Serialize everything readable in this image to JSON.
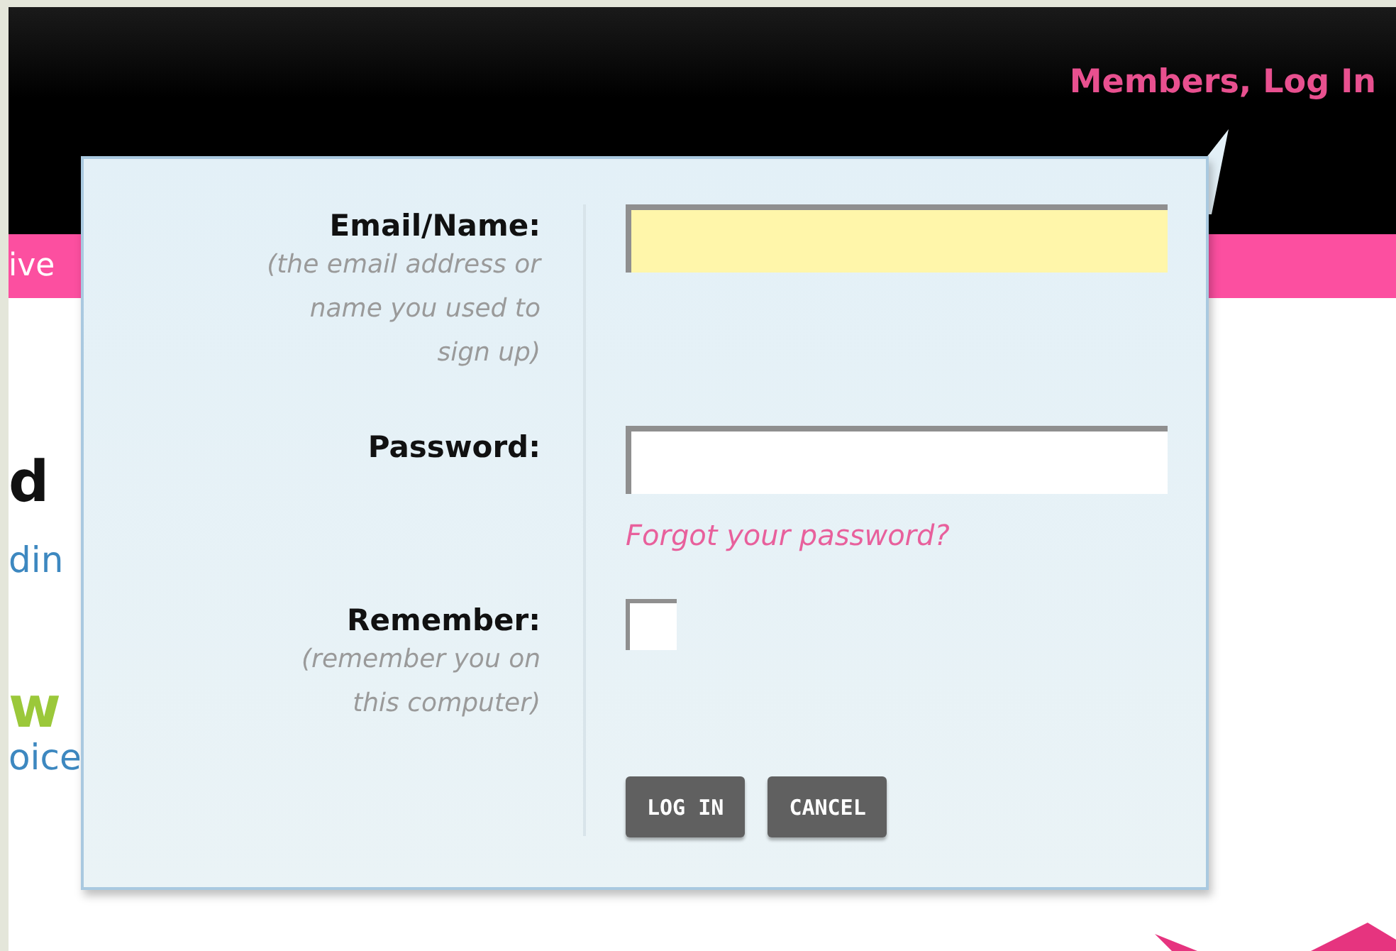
{
  "header": {
    "login_link": "Members, Log In"
  },
  "page_behind": {
    "banner_text": "ive",
    "heading_dark": "d",
    "line_1": "din",
    "heading_2": "w",
    "line_2": "oice"
  },
  "login_popup": {
    "fields": [
      {
        "kind": "text",
        "label": "Email/Name:",
        "hint": "(the email address or\nname you used to\nsign up)",
        "focused": true
      },
      {
        "kind": "password",
        "label": "Password:",
        "link": "Forgot your password?",
        "focused": false
      },
      {
        "kind": "checkbox",
        "label": "Remember:",
        "hint": "(remember you on\nthis computer)",
        "checked": false
      }
    ],
    "buttons": [
      "LOG IN",
      "CANCEL"
    ]
  }
}
